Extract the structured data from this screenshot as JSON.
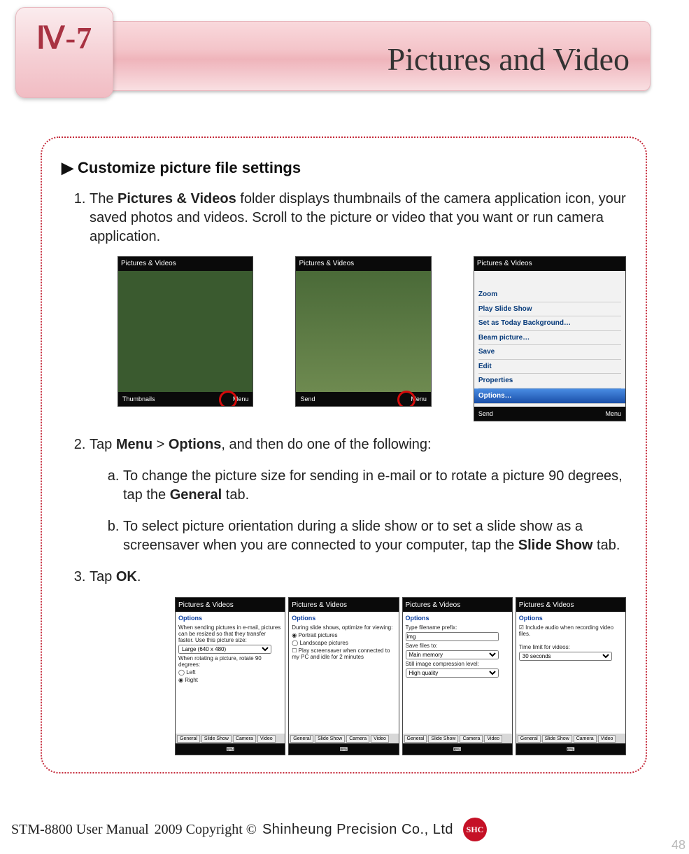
{
  "chapter": "Ⅳ-7",
  "title": "Pictures and Video",
  "section_heading": "▶ Customize picture file settings",
  "step1_pre": "The ",
  "step1_b1": "Pictures & Videos",
  "step1_post": " folder displays thumbnails of the camera application icon, your saved photos and videos. Scroll to the picture or video that you want or run camera application.",
  "step2_pre": "Tap ",
  "step2_b1": "Menu",
  "step2_mid": " > ",
  "step2_b2": "Options",
  "step2_post": ", and then do one of the following:",
  "sub_a_pre": "To change the picture size for sending in e-mail or to rotate a picture 90 degrees, tap the ",
  "sub_a_b": "General",
  "sub_a_post": " tab.",
  "sub_b_pre": "To select picture orientation during a slide show or to set a slide show as a screensaver when you are connected to your computer, tap the ",
  "sub_b_b": "Slide Show",
  "sub_b_post": " tab.",
  "step3_pre": "Tap ",
  "step3_b": "OK",
  "step3_post": ".",
  "shot_title": "Pictures & Videos",
  "shot_thumbnails": "Thumbnails",
  "shot_send": "Send",
  "shot_menu": "Menu",
  "menu_items": {
    "zoom": "Zoom",
    "play": "Play Slide Show",
    "today": "Set as Today Background…",
    "beam": "Beam picture…",
    "save": "Save",
    "edit": "Edit",
    "props": "Properties",
    "options": "Options…"
  },
  "opt_title": "Options",
  "opt1_text1": "When sending pictures in e-mail, pictures can be resized so that they transfer faster. Use this picture size:",
  "opt1_select": "Large (640 x 480)",
  "opt1_text2": "When rotating a picture, rotate 90 degrees:",
  "opt1_left": "Left",
  "opt1_right": "Right",
  "opt2_text": "During slide shows, optimize for viewing:",
  "opt2_portrait": "Portrait pictures",
  "opt2_landscape": "Landscape pictures",
  "opt2_screensaver": "Play screensaver when connected to my PC and idle for 2 minutes",
  "opt3_prefix_label": "Type filename prefix:",
  "opt3_prefix_value": "img",
  "opt3_save_label": "Save files to:",
  "opt3_save_value": "Main memory",
  "opt3_comp_label": "Still image compression level:",
  "opt3_comp_value": "High quality",
  "opt4_audio": "Include audio when recording video files.",
  "opt4_time_label": "Time limit for videos:",
  "opt4_time_value": "30 seconds",
  "tabs": {
    "general": "General",
    "slideshow": "Slide Show",
    "camera": "Camera",
    "video": "Video"
  },
  "footer": {
    "manual": "STM-8800 User Manual",
    "copy": "2009 Copyright ©",
    "company": "Shinheung Precision Co., Ltd",
    "badge": "SHC"
  },
  "pagenum": "48"
}
